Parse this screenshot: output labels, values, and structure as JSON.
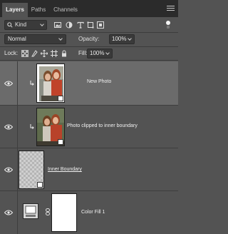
{
  "tabs": [
    {
      "label": "Layers",
      "active": true
    },
    {
      "label": "Paths",
      "active": false
    },
    {
      "label": "Channels",
      "active": false
    }
  ],
  "filter": {
    "kind_label": "Kind",
    "icons": [
      "image-filter-icon",
      "adjustment-filter-icon",
      "type-filter-icon",
      "shape-filter-icon",
      "smart-object-filter-icon"
    ]
  },
  "blend": {
    "mode": "Normal",
    "opacity_label": "Opacity:",
    "opacity_value": "100%"
  },
  "lock": {
    "label": "Lock:",
    "fill_label": "Fill:",
    "fill_value": "100%",
    "icons": [
      "lock-transparent-icon",
      "lock-image-icon",
      "lock-position-icon",
      "lock-artboard-icon",
      "lock-all-icon"
    ]
  },
  "layers": [
    {
      "name": "New Photo",
      "selected": true,
      "clipped": true,
      "visible": true
    },
    {
      "name": "Photo clipped to inner boundary",
      "selected": false,
      "clipped": true,
      "visible": true
    },
    {
      "name": "Inner Boundary",
      "selected": false,
      "clipped": false,
      "visible": true,
      "underlined": true
    },
    {
      "name": "Color Fill 1",
      "selected": false,
      "clipped": false,
      "visible": true
    }
  ],
  "colors": {
    "panel_bg": "#535353",
    "tab_bar": "#2b2b2b",
    "selected_row": "#6b6b6b",
    "fill_layer_color": "#ffffff"
  }
}
